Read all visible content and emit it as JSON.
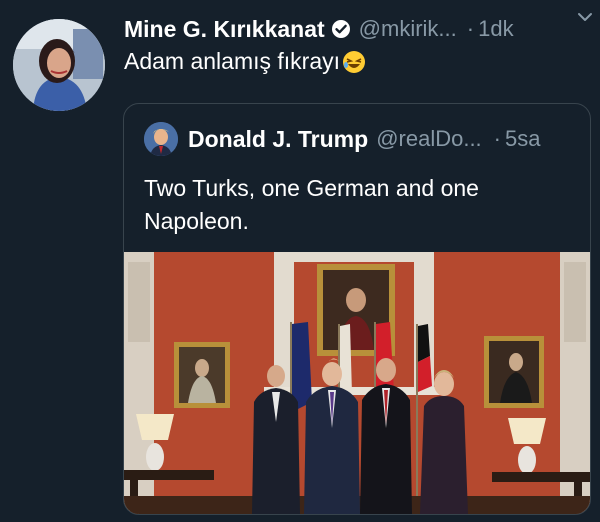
{
  "tweet": {
    "author_name": "Mine G. Kırıkkanat",
    "author_handle": "@mkirik...",
    "separator": "·",
    "timestamp": "1dk",
    "text": "Adam anlamış fıkrayı",
    "verified": true,
    "emoji": "rolling-on-floor-laughing"
  },
  "quoted_tweet": {
    "author_name": "Donald J. Trump",
    "author_handle": "@realDo...",
    "separator": "·",
    "timestamp": "5sa",
    "text": "Two Turks, one German and one Napoleon."
  },
  "colors": {
    "background": "#15202b",
    "secondary_text": "#8899a6",
    "border": "#38444d",
    "verified_badge": "#ffffff"
  }
}
